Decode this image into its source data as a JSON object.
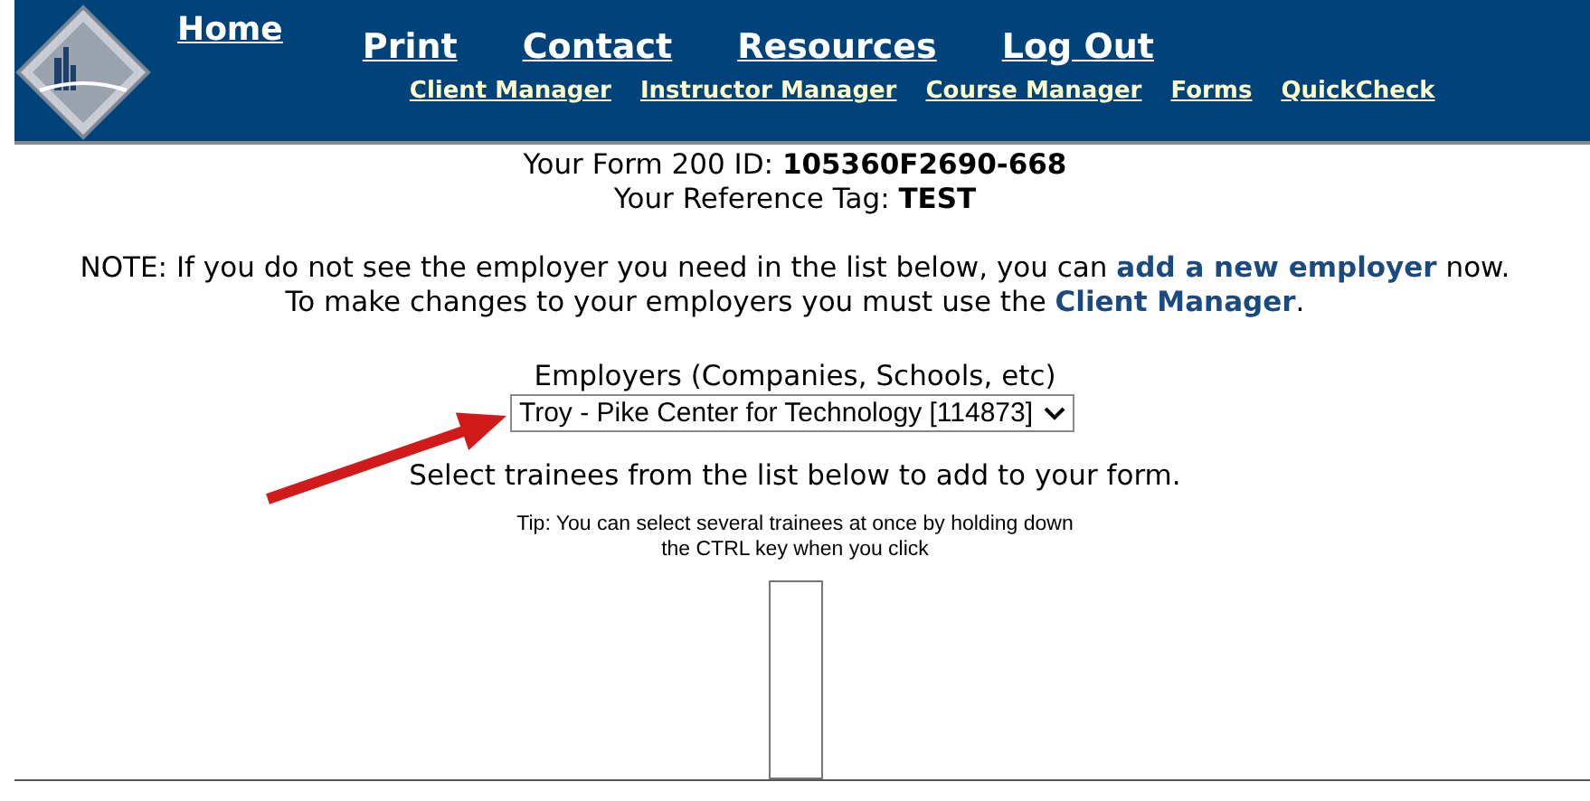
{
  "header": {
    "home": "Home",
    "nav": [
      "Print",
      "Contact",
      "Resources",
      "Log Out"
    ],
    "subnav": [
      "Client Manager",
      "Instructor Manager",
      "Course Manager",
      "Forms",
      "QuickCheck"
    ]
  },
  "form_id": "Your Form 200 ID: **105360F2690-668**",
  "reference_tag": "Your Reference Tag: **TEST**",
  "note_lines": [
    [
      {
        "kind": "text",
        "text": "NOTE: If you do not see the employer you need in the list below, you can "
      },
      {
        "kind": "link",
        "text": "add a new employer"
      },
      {
        "kind": "text",
        "text": " now."
      }
    ],
    [
      {
        "kind": "text",
        "text": "To make changes to your employers you must use the "
      },
      {
        "kind": "link",
        "text": "Client Manager"
      },
      {
        "kind": "text",
        "text": "."
      }
    ]
  ],
  "employers": {
    "label": "Employers (Companies, Schools, etc)",
    "value": "Troy - Pike Center for Technology [114873]"
  },
  "instruction": "Select trainees from the list below to add to your form.",
  "tip": [
    "Tip: You can select several trainees at once by holding down",
    "the CTRL key when you click"
  ]
}
